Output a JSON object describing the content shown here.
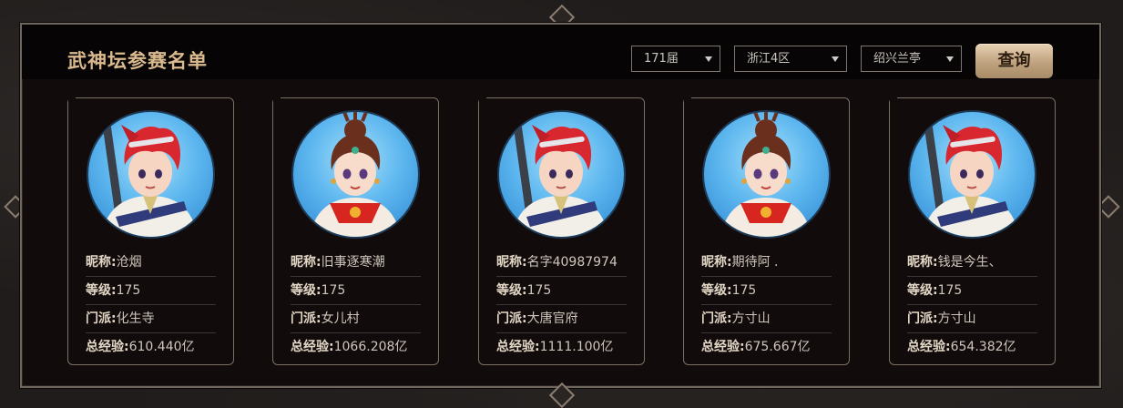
{
  "header": {
    "title": "武神坛参赛名单",
    "session_select": "171届",
    "server_select": "浙江4区",
    "subserver_select": "绍兴兰亭",
    "query_button": "查询"
  },
  "labels": {
    "nickname": "昵称:",
    "level": "等级:",
    "sect": "门派:",
    "exp": "总经验:"
  },
  "players": [
    {
      "nickname": "沧烟",
      "level": "175",
      "sect": "化生寺",
      "exp": "610.440亿",
      "avatar": "red-haired-boy-avatar"
    },
    {
      "nickname": "旧事逐寒潮",
      "level": "175",
      "sect": "女儿村",
      "exp": "1066.208亿",
      "avatar": "girl-with-bun-avatar"
    },
    {
      "nickname": "名字40987974",
      "level": "175",
      "sect": "大唐官府",
      "exp": "1111.100亿",
      "avatar": "red-haired-boy-avatar"
    },
    {
      "nickname": "期待阿 .",
      "level": "175",
      "sect": "方寸山",
      "exp": "675.667亿",
      "avatar": "girl-with-bun-avatar"
    },
    {
      "nickname": "钱是今生、",
      "level": "175",
      "sect": "方寸山",
      "exp": "654.382亿",
      "avatar": "red-haired-boy-avatar"
    }
  ],
  "colors": {
    "title": "#d9b98e",
    "frame_border": "#6f665e",
    "panel_bg": "#120b0b",
    "button_gold": "#bfa27f"
  }
}
